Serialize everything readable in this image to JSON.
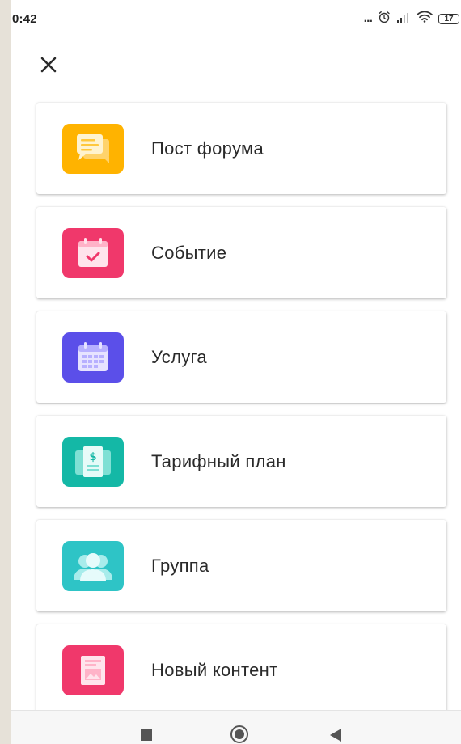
{
  "status_bar": {
    "time": "0:42",
    "dots": "...",
    "battery": "17"
  },
  "header": {
    "close_icon": "close-icon"
  },
  "items": [
    {
      "label": "Пост форума",
      "icon": "forum-post-icon",
      "color": "#FFB300"
    },
    {
      "label": "Событие",
      "icon": "event-calendar-icon",
      "color": "#F0386B"
    },
    {
      "label": "Услуга",
      "icon": "service-calendar-icon",
      "color": "#5B4FE9"
    },
    {
      "label": "Тарифный план",
      "icon": "pricing-plan-icon",
      "color": "#14B8A6"
    },
    {
      "label": "Группа",
      "icon": "group-icon",
      "color": "#2EC4C6"
    },
    {
      "label": "Новый контент",
      "icon": "new-content-icon",
      "color": "#F0386B"
    }
  ],
  "nav_bar": {
    "recent_icon": "recent-apps-icon",
    "home_icon": "home-icon",
    "back_icon": "back-icon"
  }
}
